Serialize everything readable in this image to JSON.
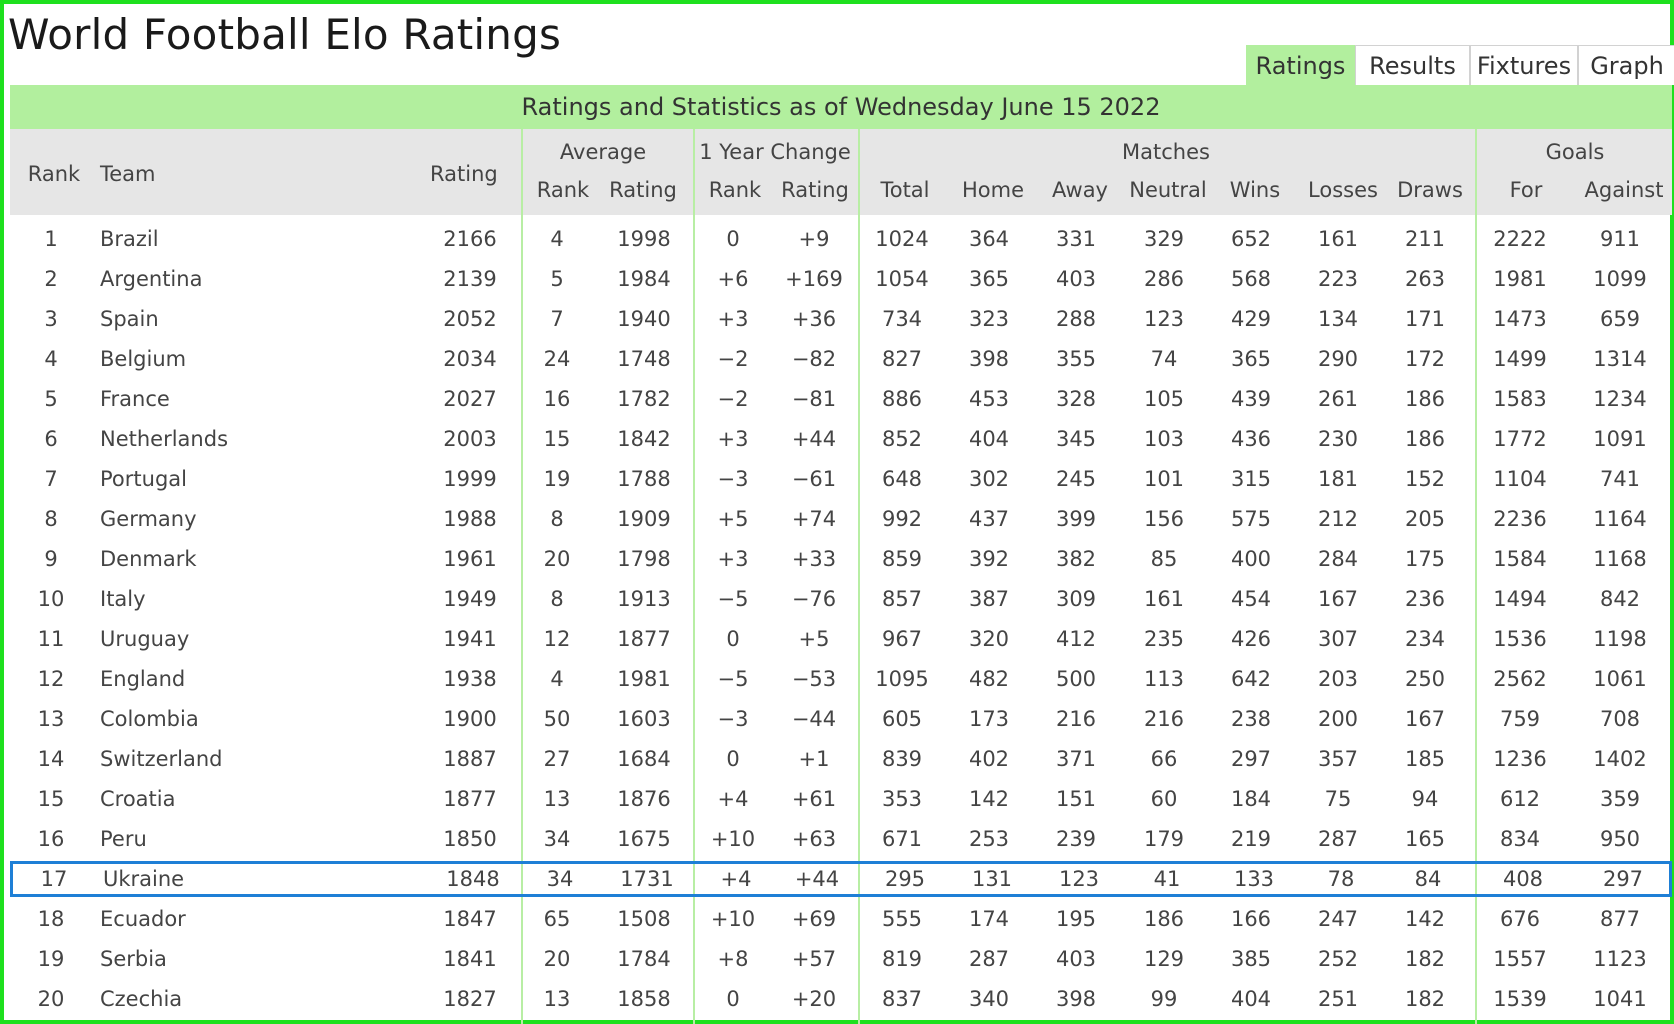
{
  "title": "World Football Elo Ratings",
  "tabs": [
    {
      "label": "Ratings",
      "active": true
    },
    {
      "label": "Results",
      "active": false
    },
    {
      "label": "Fixtures",
      "active": false
    },
    {
      "label": "Graph",
      "active": false
    }
  ],
  "subtitle": "Ratings and Statistics as of Wednesday June 15 2022",
  "colors": {
    "border_green": "#1ee01e",
    "tab_green": "#b2ef9e",
    "header_gray": "#e6e6e6",
    "highlight_blue": "#1e7fd6"
  },
  "headers": {
    "rank": "Rank",
    "team": "Team",
    "rating": "Rating",
    "average": "Average",
    "avg_rank": "Rank",
    "avg_rating": "Rating",
    "year_change": "1 Year Change",
    "chg_rank": "Rank",
    "chg_rating": "Rating",
    "matches": "Matches",
    "total": "Total",
    "home": "Home",
    "away": "Away",
    "neutral": "Neutral",
    "wins": "Wins",
    "losses": "Losses",
    "draws": "Draws",
    "goals": "Goals",
    "goals_for": "For",
    "goals_against": "Against"
  },
  "highlighted_team": "Ukraine",
  "rows": [
    [
      "1",
      "Brazil",
      "2166",
      "4",
      "1998",
      "0",
      "+9",
      "1024",
      "364",
      "331",
      "329",
      "652",
      "161",
      "211",
      "2222",
      "911"
    ],
    [
      "2",
      "Argentina",
      "2139",
      "5",
      "1984",
      "+6",
      "+169",
      "1054",
      "365",
      "403",
      "286",
      "568",
      "223",
      "263",
      "1981",
      "1099"
    ],
    [
      "3",
      "Spain",
      "2052",
      "7",
      "1940",
      "+3",
      "+36",
      "734",
      "323",
      "288",
      "123",
      "429",
      "134",
      "171",
      "1473",
      "659"
    ],
    [
      "4",
      "Belgium",
      "2034",
      "24",
      "1748",
      "−2",
      "−82",
      "827",
      "398",
      "355",
      "74",
      "365",
      "290",
      "172",
      "1499",
      "1314"
    ],
    [
      "5",
      "France",
      "2027",
      "16",
      "1782",
      "−2",
      "−81",
      "886",
      "453",
      "328",
      "105",
      "439",
      "261",
      "186",
      "1583",
      "1234"
    ],
    [
      "6",
      "Netherlands",
      "2003",
      "15",
      "1842",
      "+3",
      "+44",
      "852",
      "404",
      "345",
      "103",
      "436",
      "230",
      "186",
      "1772",
      "1091"
    ],
    [
      "7",
      "Portugal",
      "1999",
      "19",
      "1788",
      "−3",
      "−61",
      "648",
      "302",
      "245",
      "101",
      "315",
      "181",
      "152",
      "1104",
      "741"
    ],
    [
      "8",
      "Germany",
      "1988",
      "8",
      "1909",
      "+5",
      "+74",
      "992",
      "437",
      "399",
      "156",
      "575",
      "212",
      "205",
      "2236",
      "1164"
    ],
    [
      "9",
      "Denmark",
      "1961",
      "20",
      "1798",
      "+3",
      "+33",
      "859",
      "392",
      "382",
      "85",
      "400",
      "284",
      "175",
      "1584",
      "1168"
    ],
    [
      "10",
      "Italy",
      "1949",
      "8",
      "1913",
      "−5",
      "−76",
      "857",
      "387",
      "309",
      "161",
      "454",
      "167",
      "236",
      "1494",
      "842"
    ],
    [
      "11",
      "Uruguay",
      "1941",
      "12",
      "1877",
      "0",
      "+5",
      "967",
      "320",
      "412",
      "235",
      "426",
      "307",
      "234",
      "1536",
      "1198"
    ],
    [
      "12",
      "England",
      "1938",
      "4",
      "1981",
      "−5",
      "−53",
      "1095",
      "482",
      "500",
      "113",
      "642",
      "203",
      "250",
      "2562",
      "1061"
    ],
    [
      "13",
      "Colombia",
      "1900",
      "50",
      "1603",
      "−3",
      "−44",
      "605",
      "173",
      "216",
      "216",
      "238",
      "200",
      "167",
      "759",
      "708"
    ],
    [
      "14",
      "Switzerland",
      "1887",
      "27",
      "1684",
      "0",
      "+1",
      "839",
      "402",
      "371",
      "66",
      "297",
      "357",
      "185",
      "1236",
      "1402"
    ],
    [
      "15",
      "Croatia",
      "1877",
      "13",
      "1876",
      "+4",
      "+61",
      "353",
      "142",
      "151",
      "60",
      "184",
      "75",
      "94",
      "612",
      "359"
    ],
    [
      "16",
      "Peru",
      "1850",
      "34",
      "1675",
      "+10",
      "+63",
      "671",
      "253",
      "239",
      "179",
      "219",
      "287",
      "165",
      "834",
      "950"
    ],
    [
      "17",
      "Ukraine",
      "1848",
      "34",
      "1731",
      "+4",
      "+44",
      "295",
      "131",
      "123",
      "41",
      "133",
      "78",
      "84",
      "408",
      "297"
    ],
    [
      "18",
      "Ecuador",
      "1847",
      "65",
      "1508",
      "+10",
      "+69",
      "555",
      "174",
      "195",
      "186",
      "166",
      "247",
      "142",
      "676",
      "877"
    ],
    [
      "19",
      "Serbia",
      "1841",
      "20",
      "1784",
      "+8",
      "+57",
      "819",
      "287",
      "403",
      "129",
      "385",
      "252",
      "182",
      "1557",
      "1123"
    ],
    [
      "20",
      "Czechia",
      "1827",
      "13",
      "1858",
      "0",
      "+20",
      "837",
      "340",
      "398",
      "99",
      "404",
      "251",
      "182",
      "1539",
      "1041"
    ]
  ]
}
